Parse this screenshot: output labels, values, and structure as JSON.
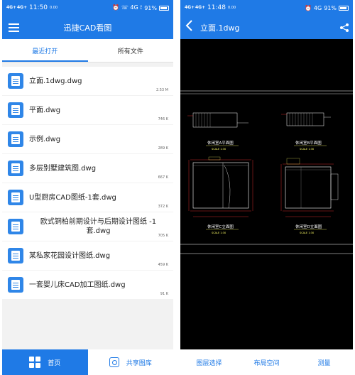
{
  "left": {
    "status": {
      "sig1": "4G+",
      "sig2": "4G+",
      "time": "11:50",
      "speed": "0.00",
      "icons": "⏰ ☏ 4G ⟟",
      "battery": "91%"
    },
    "appbar": {
      "title": "迅捷CAD看图"
    },
    "tabs": [
      {
        "label": "最近打开"
      },
      {
        "label": "所有文件"
      }
    ],
    "files": [
      {
        "name": "立面.1dwg.dwg",
        "size": "2.53 M"
      },
      {
        "name": "平面.dwg",
        "size": "746 K"
      },
      {
        "name": "示例.dwg",
        "size": "289 K"
      },
      {
        "name": "多层别墅建筑图.dwg",
        "size": "667 K"
      },
      {
        "name": "U型厨房CAD图纸-1套.dwg",
        "size": "372 K"
      },
      {
        "name": "欧式铜柏前期设计与后期设计图纸 -1套.dwg",
        "size": "705 K"
      },
      {
        "name": "某私家花园设计图纸.dwg",
        "size": "459 K"
      },
      {
        "name": "一套婴儿床CAD加工图纸.dwg",
        "size": "91 K"
      }
    ],
    "nav": {
      "home": "首页",
      "share": "共享图库"
    }
  },
  "right": {
    "status": {
      "sig1": "4G+",
      "sig2": "4G+",
      "time": "11:48",
      "speed": "0.00",
      "icons": "⏰ 4G",
      "battery": "91%"
    },
    "title": "立面.1dwg",
    "cad": {
      "view_a": "休闲室A平面图",
      "view_b": "休闲室B平面图",
      "view_c": "休闲室C立面图",
      "view_d": "休闲室D立面图",
      "scale_a": "SCALE   1:30",
      "scale_b": "SCALE   1:30",
      "scale_c": "SCALE   1:30",
      "scale_d": "SCALE   1:30"
    },
    "nav": {
      "layers": "图层选择",
      "layout": "布局空间",
      "measure": "测量"
    }
  },
  "colors": {
    "brand": "#1f7ae6",
    "cad_line": "#ffffff",
    "cad_accent": "#ff3333",
    "cad_text": "#ffff66"
  }
}
